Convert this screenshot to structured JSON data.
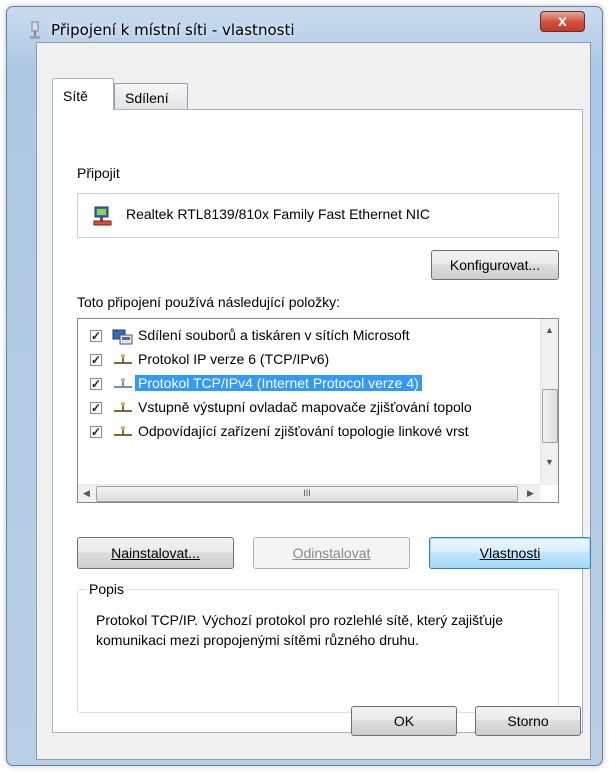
{
  "window": {
    "title": "Připojení k místní síti - vlastnosti",
    "close_label": "x"
  },
  "tabs": [
    {
      "label": "Sítě",
      "active": true
    },
    {
      "label": "Sdílení",
      "active": false
    }
  ],
  "connect": {
    "label": "Připojit",
    "adapter_name": "Realtek RTL8139/810x Family Fast Ethernet NIC",
    "configure_button": "Konfigurovat..."
  },
  "items_section": {
    "label": "Toto připojení používá následující položky:",
    "items": [
      {
        "label": "Sdílení souborů a tiskáren v sítích Microsoft",
        "checked": true,
        "icon": "network-service-icon",
        "selected": false
      },
      {
        "label": "Protokol IP verze 6 (TCP/IPv6)",
        "checked": true,
        "icon": "protocol-icon",
        "selected": false
      },
      {
        "label": "Protokol TCP/IPv4 (Internet Protocol verze 4)",
        "checked": true,
        "icon": "protocol-icon",
        "selected": true
      },
      {
        "label": "Vstupně výstupní ovladač mapovače zjišťování topolo",
        "checked": true,
        "icon": "protocol-icon",
        "selected": false
      },
      {
        "label": "Odpovídající zařízení zjišťování topologie linkové vrst",
        "checked": true,
        "icon": "protocol-icon",
        "selected": false
      }
    ],
    "hscroll_thumb": "III"
  },
  "actions": {
    "install": "Nainstalovat...",
    "uninstall": "Odinstalovat",
    "properties": "Vlastnosti"
  },
  "description": {
    "legend": "Popis",
    "text": "Protokol TCP/IP. Výchozí protokol pro rozlehlé sítě, který zajišťuje komunikaci mezi propojenými sítěmi různého druhu."
  },
  "footer": {
    "ok": "OK",
    "cancel": "Storno"
  },
  "colors": {
    "selection": "#3399ff",
    "close_button": "#c23a26"
  }
}
